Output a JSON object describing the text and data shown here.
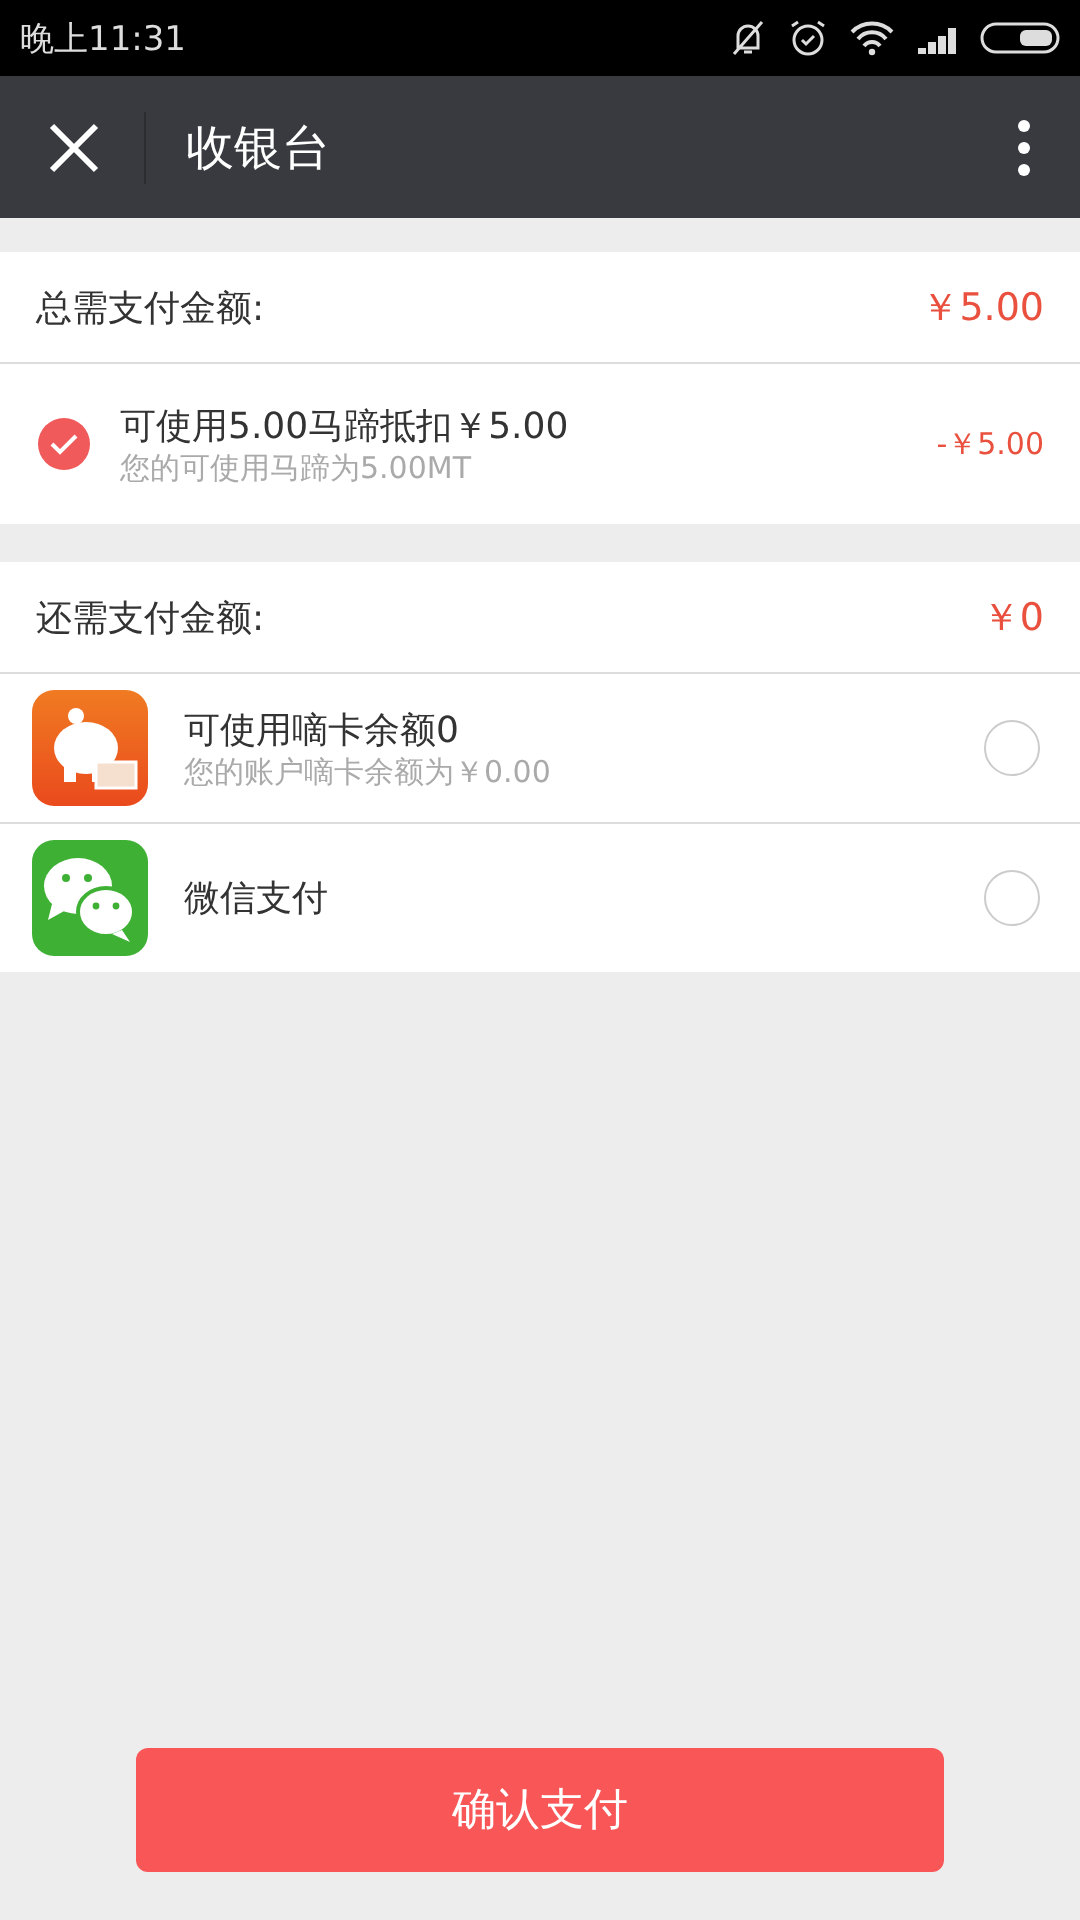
{
  "status_bar": {
    "time": "晚上11:31"
  },
  "header": {
    "title": "收银台"
  },
  "total": {
    "label": "总需支付金额:",
    "amount": "￥5.00"
  },
  "discount": {
    "checked": true,
    "title": "可使用5.00马蹄抵扣￥5.00",
    "subtitle": "您的可使用马蹄为5.00MT",
    "amount": "-￥5.00"
  },
  "remaining": {
    "label": "还需支付金额:",
    "amount": "￥0"
  },
  "methods": [
    {
      "kind": "piggy",
      "title": "可使用嘀卡余额0",
      "subtitle": "您的账户嘀卡余额为￥0.00",
      "selected": false
    },
    {
      "kind": "wechat",
      "title": "微信支付",
      "selected": false
    }
  ],
  "confirm_button": "确认支付"
}
